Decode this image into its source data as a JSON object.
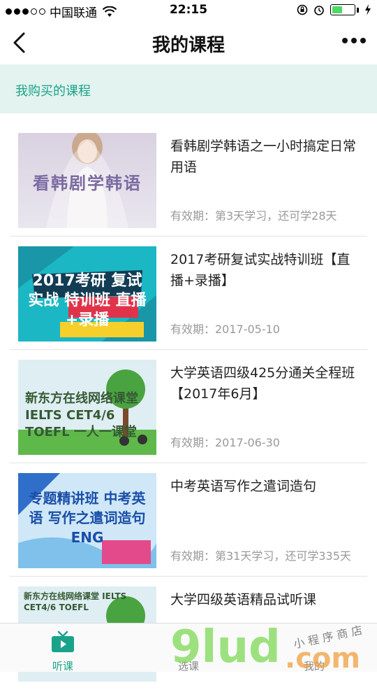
{
  "status_bar": {
    "carrier": "中国联通",
    "time": "22:15",
    "signal_dots_filled": 3,
    "signal_dots_total": 5,
    "battery_level": 0.45
  },
  "nav": {
    "title": "我的课程",
    "back_icon": "chevron-left-icon",
    "more_icon": "more-dots-icon"
  },
  "section": {
    "title": "我购买的课程"
  },
  "courses": [
    {
      "title": "看韩剧学韩语之一小时搞定日常用语",
      "validity": "有效期：第3天学习，还可学28天",
      "thumb_text": "看韩剧学韩语"
    },
    {
      "title": "2017考研复试实战特训班【直播+录播】",
      "validity": "有效期：2017-05-10",
      "thumb_text": "2017考研 复试实战 特训班 直播+录播"
    },
    {
      "title": "大学英语四级425分通关全程班 【2017年6月】",
      "validity": "有效期：2017-06-30",
      "thumb_text": "新东方在线网络课堂 IELTS CET4/6 TOEFL 一人一课堂"
    },
    {
      "title": "中考英语写作之遣词造句",
      "validity": "有效期：第31天学习，还可学335天",
      "thumb_text": "专题精讲班 中考英语 写作之遣词造句 ENG"
    },
    {
      "title": "大学四级英语精品试听课",
      "validity": "",
      "thumb_text": "新东方在线网络课堂 IELTS CET4/6 TOEFL"
    }
  ],
  "tabs": [
    {
      "label": "听课",
      "icon": "tv-play-icon",
      "active": true
    },
    {
      "label": "选课",
      "icon": "",
      "active": false
    },
    {
      "label": "我的",
      "icon": "",
      "active": false
    }
  ],
  "watermark": {
    "text": "9lud.com",
    "tagline": "小程序商店"
  },
  "colors": {
    "accent": "#1aa38a",
    "section_bg": "#e3f3ef",
    "muted_text": "#999999"
  }
}
